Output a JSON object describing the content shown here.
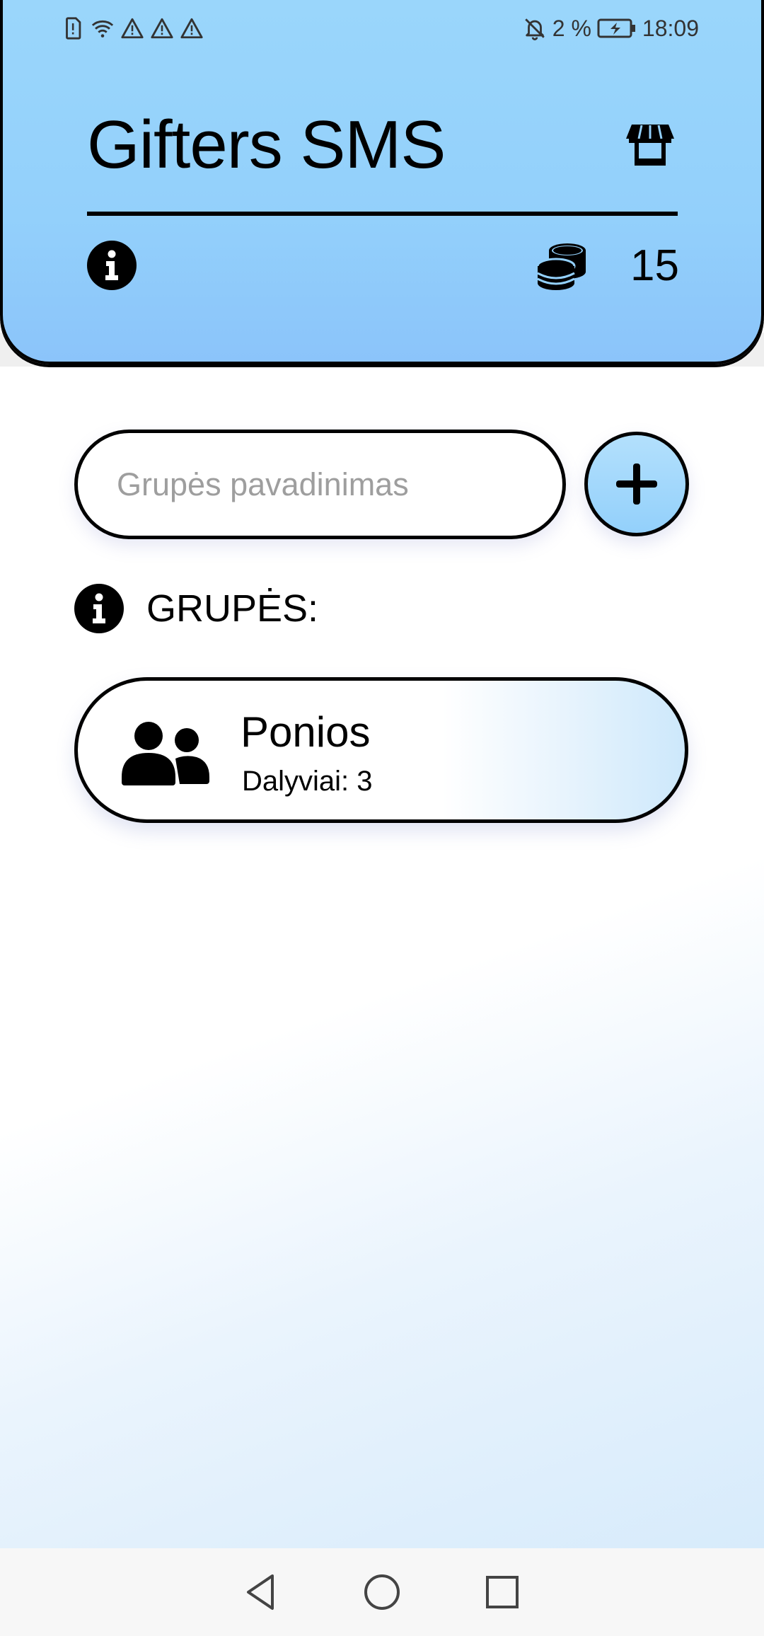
{
  "status_bar": {
    "battery_percent": "2 %",
    "time": "18:09",
    "left_icons": [
      "sim-alert-icon",
      "wifi-icon",
      "warning-icon",
      "warning-icon",
      "warning-icon"
    ],
    "right_icons": [
      "bell-off-icon",
      "battery-charging-icon"
    ]
  },
  "header": {
    "title": "Gifters SMS",
    "coins": "15",
    "icons": [
      "store-icon",
      "info-icon",
      "coins-icon"
    ],
    "colors": {
      "gradient_top": "#9ad6fb",
      "gradient_bottom": "#8bc4fa"
    }
  },
  "create_group": {
    "input_value": "",
    "placeholder": "Grupės pavadinimas",
    "add_icon": "plus-icon"
  },
  "groups_section": {
    "title": "GRUPĖS:",
    "info_icon": "info-icon"
  },
  "groups": [
    {
      "name": "Ponios",
      "members_text": "Dalyviai: 3",
      "icon": "users-icon"
    }
  ],
  "nav_bar": {
    "buttons": [
      "back-icon",
      "home-icon",
      "recents-icon"
    ]
  }
}
